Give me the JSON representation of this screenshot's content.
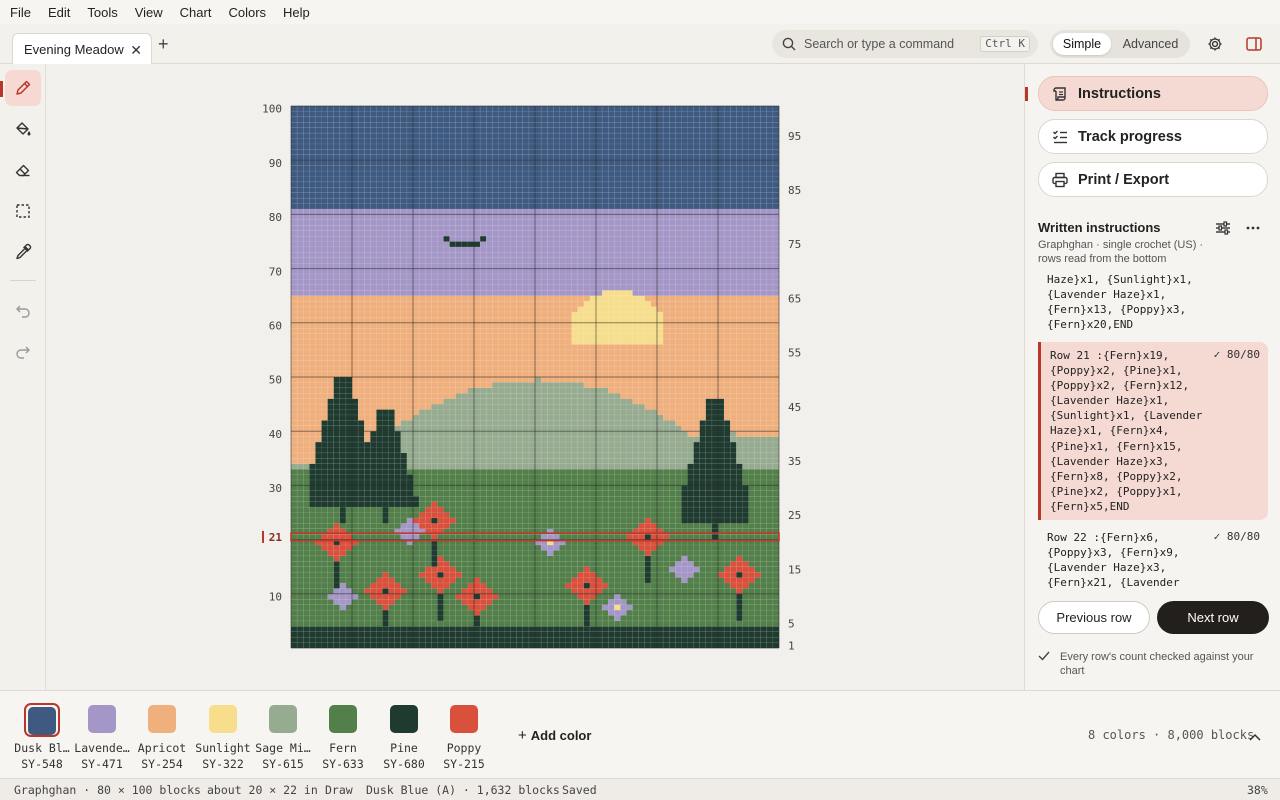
{
  "menu": [
    "File",
    "Edit",
    "Tools",
    "View",
    "Chart",
    "Colors",
    "Help"
  ],
  "tab": {
    "title": "Evening Meadow"
  },
  "search": {
    "placeholder": "Search or type a command",
    "shortcut": "Ctrl K"
  },
  "mode": {
    "simple": "Simple",
    "advanced": "Advanced",
    "selected": "Simple"
  },
  "tools": [
    "pencil-icon",
    "fill-bucket-icon",
    "eraser-icon",
    "select-icon",
    "eyedropper-icon",
    "undo-icon",
    "redo-icon"
  ],
  "chart_data": {
    "type": "heatmap",
    "columns": 80,
    "rows": 100,
    "current_row": 21,
    "left_axis_labels": [
      "100",
      "90",
      "80",
      "70",
      "60",
      "50",
      "40",
      "30",
      "10"
    ],
    "right_axis_labels": [
      "95",
      "85",
      "75",
      "65",
      "55",
      "45",
      "35",
      "25",
      "15",
      "5",
      "1"
    ],
    "current_row_label": "21",
    "regions": [
      {
        "color": "Dusk Blue",
        "rows": [
          82,
          100
        ]
      },
      {
        "color": "Lavender Haze",
        "rows": [
          66,
          81
        ]
      },
      {
        "color": "Apricot",
        "rows": [
          44,
          65
        ]
      },
      {
        "color": "Sage Mist",
        "rows": [
          34,
          51
        ]
      },
      {
        "color": "Fern",
        "rows": [
          5,
          33
        ]
      },
      {
        "color": "Pine",
        "rows": [
          1,
          4
        ]
      }
    ]
  },
  "panel": {
    "nav": [
      "Instructions",
      "Track progress",
      "Print / Export"
    ],
    "active_nav": "Instructions",
    "written_title": "Written instructions",
    "written_subtitle": "Graphghan · single crochet (US) · rows read from the bottom",
    "prev_text": "Haze}x1, {Sunlight}x1,\n{Lavender Haze}x1,\n{Fern}x13, {Poppy}x3,\n{Fern}x20,END",
    "rows": [
      {
        "text": "Row 21 :{Fern}x19,\n{Poppy}x2, {Pine}x1,\n{Poppy}x2, {Fern}x12,\n{Lavender Haze}x1,\n{Sunlight}x1, {Lavender\nHaze}x1, {Fern}x4,\n{Pine}x1, {Fern}x15,\n{Lavender Haze}x3,\n{Fern}x8, {Poppy}x2,\n{Pine}x2, {Poppy}x1,\n{Fern}x5,END",
        "count": "✓ 80/80"
      },
      {
        "text": "Row 22 :{Fern}x6,\n{Poppy}x3, {Fern}x9,\n{Lavender Haze}x3,\n{Fern}x21, {Lavender",
        "count": "✓ 80/80"
      }
    ],
    "prev_button": "Previous row",
    "next_button": "Next row",
    "verification": "Every row's count checked against your chart"
  },
  "palette": {
    "colors": [
      {
        "name": "Dusk Blue",
        "display": "Dusk Bl…",
        "code": "SY-548",
        "hex": "#3f5a80"
      },
      {
        "name": "Lavender Haze",
        "display": "Lavende…",
        "code": "SY-471",
        "hex": "#a496c7"
      },
      {
        "name": "Apricot",
        "display": "Apricot",
        "code": "SY-254",
        "hex": "#efb07e"
      },
      {
        "name": "Sunlight",
        "display": "Sunlight",
        "code": "SY-322",
        "hex": "#f6de8c"
      },
      {
        "name": "Sage Mist",
        "display": "Sage Mi…",
        "code": "SY-615",
        "hex": "#97ab90"
      },
      {
        "name": "Fern",
        "display": "Fern",
        "code": "SY-633",
        "hex": "#537f4a"
      },
      {
        "name": "Pine",
        "display": "Pine",
        "code": "SY-680",
        "hex": "#1f3b30"
      },
      {
        "name": "Poppy",
        "display": "Poppy",
        "code": "SY-215",
        "hex": "#d9503d"
      }
    ],
    "selected": "Dusk Blue",
    "add_label": "Add color",
    "summary": "8 colors · 8,000 blocks"
  },
  "status": {
    "app": "Graphghan · 80 × 100 blocks",
    "size": "about 20 × 22 in",
    "tool": "Draw",
    "color_info": "Dusk Blue (A) · 1,632 blocks",
    "saved": "Saved",
    "zoom": "38%"
  },
  "accent": "#b8372a"
}
